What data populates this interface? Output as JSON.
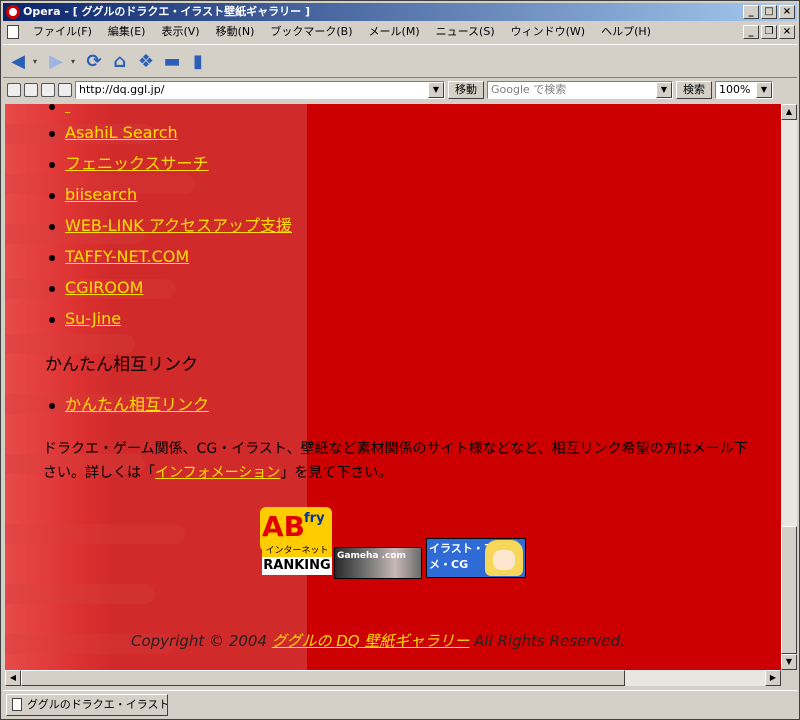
{
  "window": {
    "title": "Opera - [ ググルのドラクエ・イラスト壁紙ギャラリー ]",
    "controls": [
      "_",
      "□",
      "×"
    ]
  },
  "menubar": {
    "items": [
      "ファイル(F)",
      "編集(E)",
      "表示(V)",
      "移動(N)",
      "ブックマーク(B)",
      "メール(M)",
      "ニュース(S)",
      "ウィンドウ(W)",
      "ヘルプ(H)"
    ],
    "mdi_controls": [
      "_",
      "❐",
      "×"
    ]
  },
  "addressbar": {
    "url": "http://dq.ggl.jp/",
    "go_label": "移動",
    "search_placeholder": "Google で検索",
    "search_button": "検索",
    "zoom": "100%"
  },
  "content": {
    "links_top": [
      "AsahiL Search",
      "フェニックスサーチ",
      "biisearch",
      "WEB-LINK アクセスアップ支援",
      "TAFFY-NET.COM",
      "CGIROOM",
      "Su-Jine"
    ],
    "section_heading": "かんたん相互リンク",
    "section_link": "かんたん相互リンク",
    "paragraph_part1": "ドラクエ・ゲーム関係、CG・イラスト、壁紙など素材関係のサイト様などなど、相互リンク希望の方はメール下さい。詳しくは「",
    "paragraph_link": "インフォメーション",
    "paragraph_part2": "」を見て下さい。",
    "banners": {
      "ab_main": "AB",
      "ab_fry": "fry",
      "ab_net": "インターネット総合",
      "ab_rank": "RANKING",
      "gameha": "Gameha .com",
      "illust": "イラスト・アニメ・CG"
    },
    "copyright_prefix": "Copyright © 2004 ",
    "copyright_link": "ググルの DQ 壁紙ギャラリー",
    "copyright_suffix": " All Rights Reserved."
  },
  "taskbar": {
    "task_label": "ググルのドラクエ・イラスト..."
  },
  "colors": {
    "page_bg": "#cc0000",
    "link": "#ffe000",
    "titlebar_start": "#0a246a",
    "titlebar_end": "#a6caf0"
  }
}
